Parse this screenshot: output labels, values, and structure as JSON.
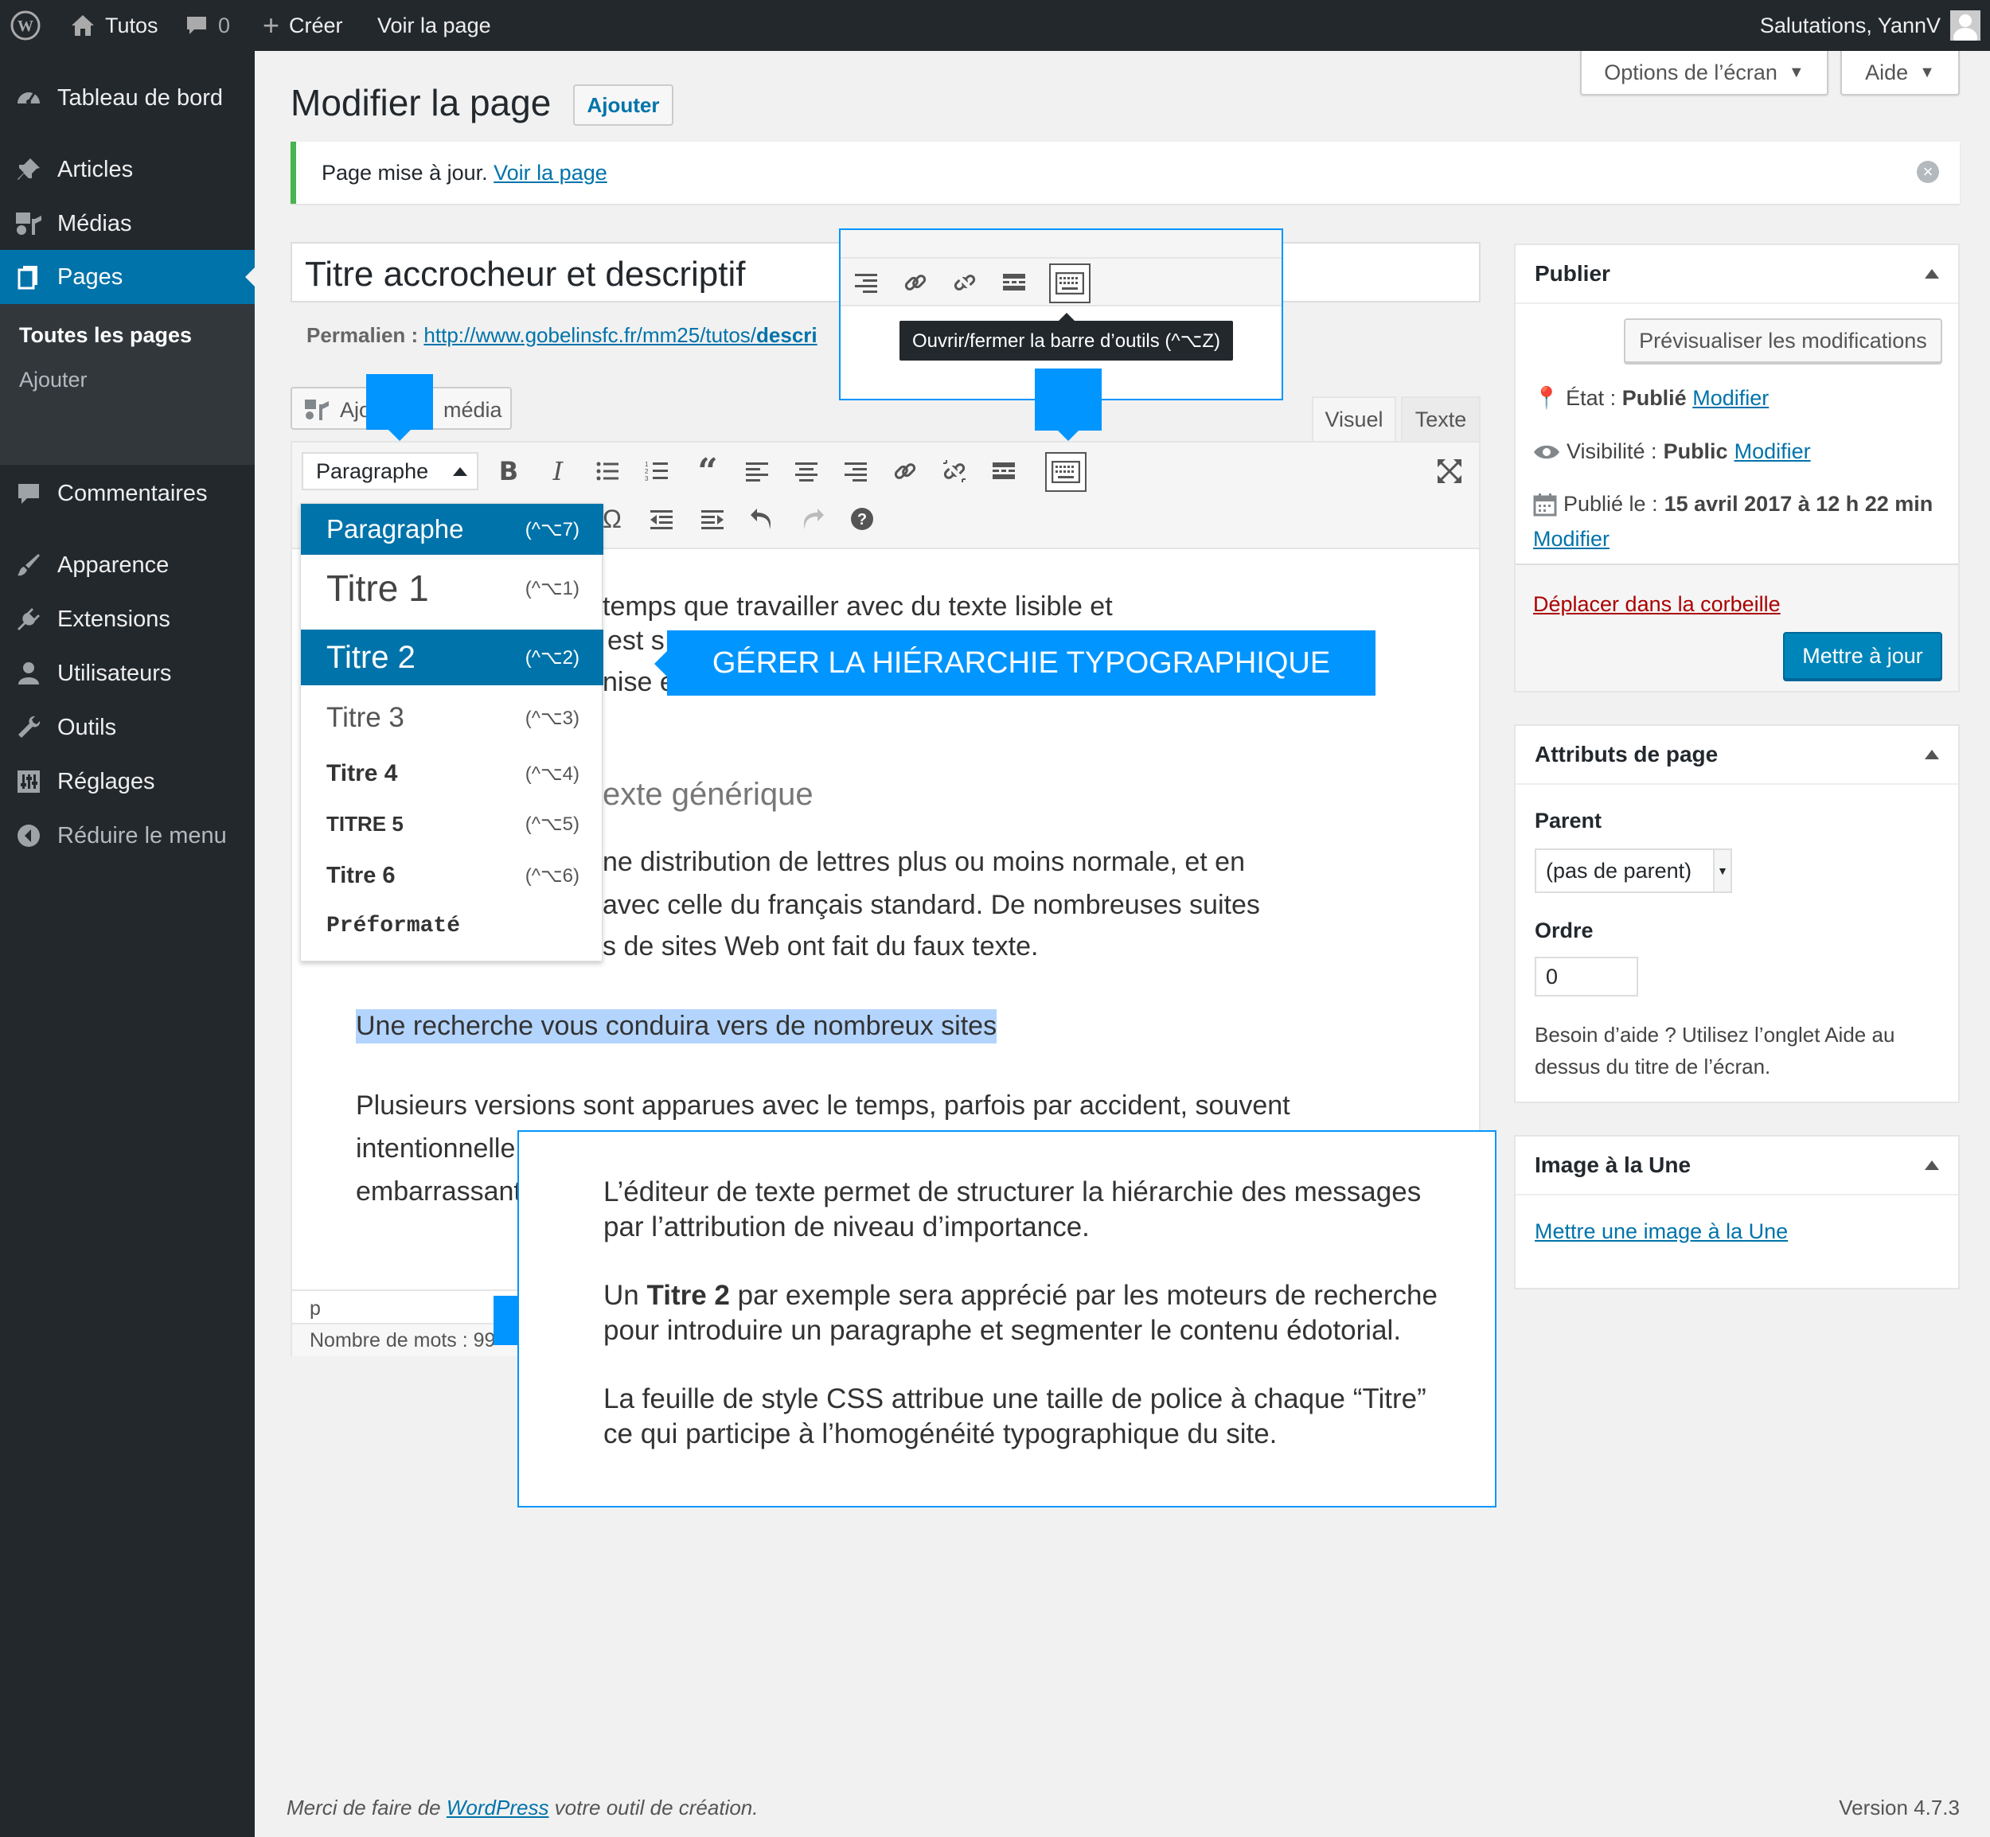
{
  "adminbar": {
    "site_name": "Tutos",
    "comments_count": "0",
    "new_label": "Créer",
    "view_page": "Voir la page",
    "greeting": "Salutations, YannV"
  },
  "sidebar": {
    "items": [
      {
        "label": "Tableau de bord",
        "icon": "dashboard-icon"
      },
      {
        "label": "Articles",
        "icon": "pin-icon"
      },
      {
        "label": "Médias",
        "icon": "media-icon"
      },
      {
        "label": "Pages",
        "icon": "pages-icon"
      },
      {
        "label": "Commentaires",
        "icon": "comment-icon"
      },
      {
        "label": "Apparence",
        "icon": "brush-icon"
      },
      {
        "label": "Extensions",
        "icon": "plugin-icon"
      },
      {
        "label": "Utilisateurs",
        "icon": "user-icon"
      },
      {
        "label": "Outils",
        "icon": "wrench-icon"
      },
      {
        "label": "Réglages",
        "icon": "settings-icon"
      },
      {
        "label": "Réduire le menu",
        "icon": "collapse-icon"
      }
    ],
    "submenu": [
      "Toutes les pages",
      "Ajouter"
    ]
  },
  "screen_meta": {
    "options": "Options de l’écran",
    "help": "Aide"
  },
  "page": {
    "title": "Modifier la page",
    "add_new": "Ajouter",
    "notice_text": "Page mise à jour.",
    "notice_link": "Voir la page"
  },
  "editor": {
    "post_title": "Titre accrocheur et descriptif",
    "permalink_label": "Permalien :",
    "permalink_url": "http://www.gobelinsfc.fr/mm25/tutos/",
    "permalink_slug": "descri",
    "add_media_1": "Ajo",
    "add_media_2": "média",
    "tab_visual": "Visuel",
    "tab_text": "Texte",
    "format_select": "Paragraphe",
    "content": {
      "line1": "temps que travailler avec du texte lisible et",
      "line2a": "est s",
      "line3a": "nise e",
      "heading": "exte générique",
      "p2_line1": "ne distribution de lettres plus ou moins normale, et en",
      "p2_line2": "avec celle du français standard. De nombreuses suites",
      "p2_line3": "s de sites Web ont fait du faux texte.",
      "selected": "Une recherche vous conduira vers de nombreux sites",
      "p4_line1": "Plusieurs versions sont apparues avec le temps, parfois par accident, souvent",
      "p4_line2": "intentionnelle",
      "p4_line3": "embarrassant"
    },
    "path": "p",
    "word_count": "Nombre de mots : 99"
  },
  "dropdown": [
    {
      "label": "Paragraphe",
      "shortcut": "(^⌥7)"
    },
    {
      "label": "Titre 1",
      "shortcut": "(^⌥1)"
    },
    {
      "label": "Titre 2",
      "shortcut": "(^⌥2)"
    },
    {
      "label": "Titre 3",
      "shortcut": "(^⌥3)"
    },
    {
      "label": "Titre 4",
      "shortcut": "(^⌥4)"
    },
    {
      "label": "TITRE 5",
      "shortcut": "(^⌥5)"
    },
    {
      "label": "Titre 6",
      "shortcut": "(^⌥6)"
    },
    {
      "label": "Préformaté",
      "shortcut": ""
    }
  ],
  "zoom_tooltip": "Ouvrir/fermer la barre d’outils (^⌥Z)",
  "callout": "GÉRER LA HIÉRARCHIE TYPOGRAPHIQUE",
  "info_box": {
    "p1": "L’éditeur de texte permet de structurer la hiérarchie des messages par l’attribution de niveau d’importance.",
    "p2_pre": "Un ",
    "p2_bold": "Titre 2",
    "p2_post": " par exemple sera apprécié par les moteurs de recherche pour introduire un paragraphe et segmenter le contenu édotorial.",
    "p3": "La feuille de style CSS attribue une taille de police à chaque “Titre” ce qui participe à l’homogénéité typographique du site."
  },
  "publish": {
    "title": "Publier",
    "preview": "Prévisualiser les modifications",
    "status_label": "État :",
    "status_value": "Publié",
    "visibility_label": "Visibilité :",
    "visibility_value": "Public",
    "published_label": "Publié le :",
    "published_value": "15 avril 2017 à 12 h 22 min",
    "edit": "Modifier",
    "trash": "Déplacer dans la corbeille",
    "update": "Mettre à jour"
  },
  "attributes": {
    "title": "Attributs de page",
    "parent_label": "Parent",
    "parent_value": "(pas de parent)",
    "order_label": "Ordre",
    "order_value": "0",
    "help": "Besoin d’aide ? Utilisez l’onglet Aide au dessus du titre de l’écran."
  },
  "featured": {
    "title": "Image à la Une",
    "link": "Mettre une image à la Une"
  },
  "footer": {
    "thanks_pre": "Merci de faire de ",
    "thanks_link": "WordPress",
    "thanks_post": " votre outil de création.",
    "version": "Version 4.7.3"
  },
  "colors": {
    "admin_dark": "#23282d",
    "accent": "#0073aa",
    "highlight": "#0095ff",
    "notice_green": "#46b450",
    "trash_red": "#a00"
  }
}
